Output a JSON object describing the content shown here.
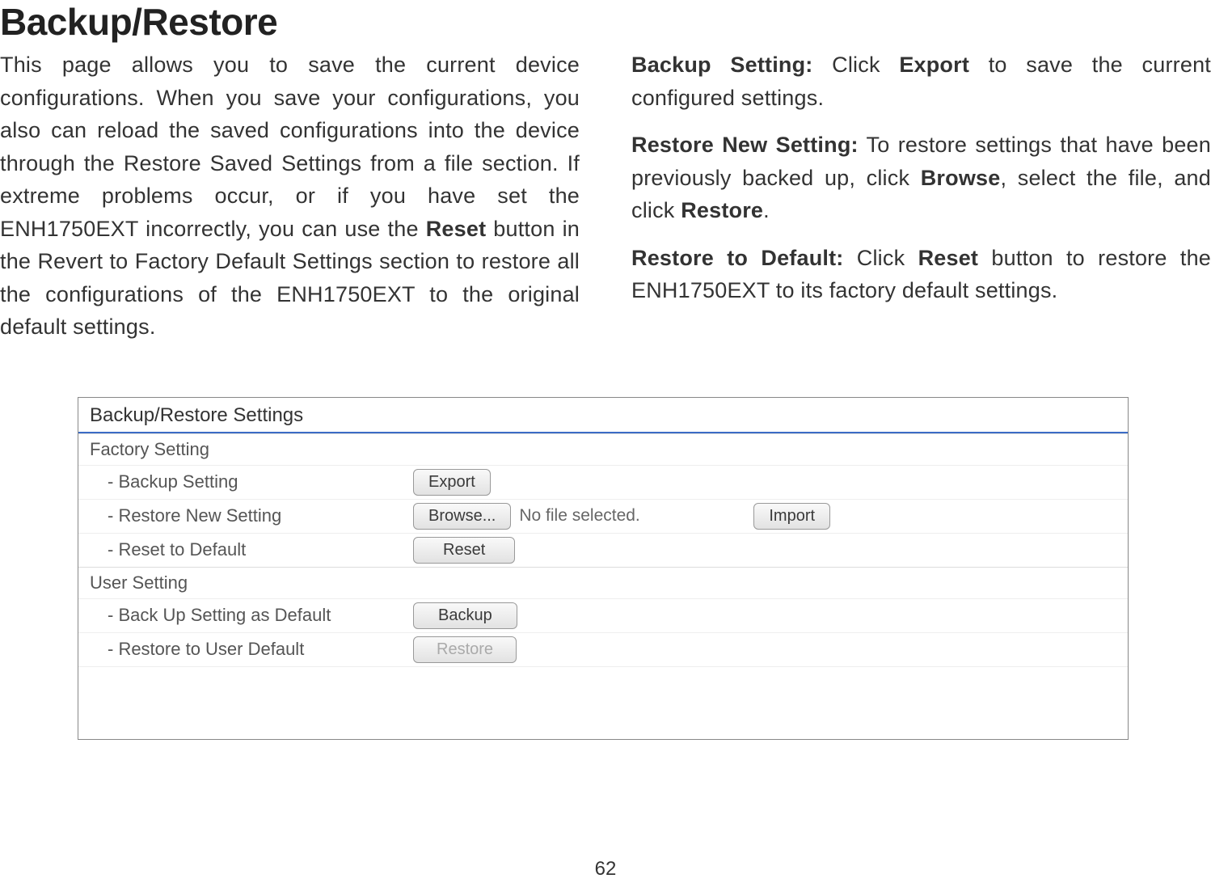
{
  "title": "Backup/Restore",
  "left_col": {
    "para1_pre": "This page allows you to save the current device configurations. When you save your configurations, you also can reload the saved configurations into the device through the Restore Saved Settings from a file section. If extreme problems occur, or if you have set the ENH1750EXT incorrectly, you can use the ",
    "reset_word": "Reset",
    "para1_post": " button in the Revert to Factory Default Settings section to restore all the configurations of the ENH1750EXT to the original default settings."
  },
  "right_col": {
    "p1_label": "Backup Setting:",
    "p1_mid1": " Click ",
    "p1_bold1": "Export",
    "p1_tail": " to save the current configured settings.",
    "p2_label": "Restore New Setting:",
    "p2_mid1": " To restore settings that have been previously backed up, click ",
    "p2_bold1": "Browse",
    "p2_mid2": ", select the file, and click ",
    "p2_bold2": "Restore",
    "p2_tail": ".",
    "p3_label": "Restore to Default:",
    "p3_mid1": " Click ",
    "p3_bold1": "Reset",
    "p3_tail": " button to restore the ENH1750EXT to its factory default settings."
  },
  "panel": {
    "title": "Backup/Restore Settings",
    "factory_label": "Factory Setting",
    "rows_factory": {
      "r1_label": "- Backup Setting",
      "r1_btn": "Export",
      "r2_label": "- Restore New Setting",
      "r2_browse": "Browse...",
      "r2_file": "No file selected.",
      "r2_import": "Import",
      "r3_label": "- Reset to Default",
      "r3_btn": "Reset"
    },
    "user_label": "User Setting",
    "rows_user": {
      "r4_label": "- Back Up Setting as Default",
      "r4_btn": "Backup",
      "r5_label": "- Restore to User Default",
      "r5_btn": "Restore"
    }
  },
  "page_number": "62"
}
